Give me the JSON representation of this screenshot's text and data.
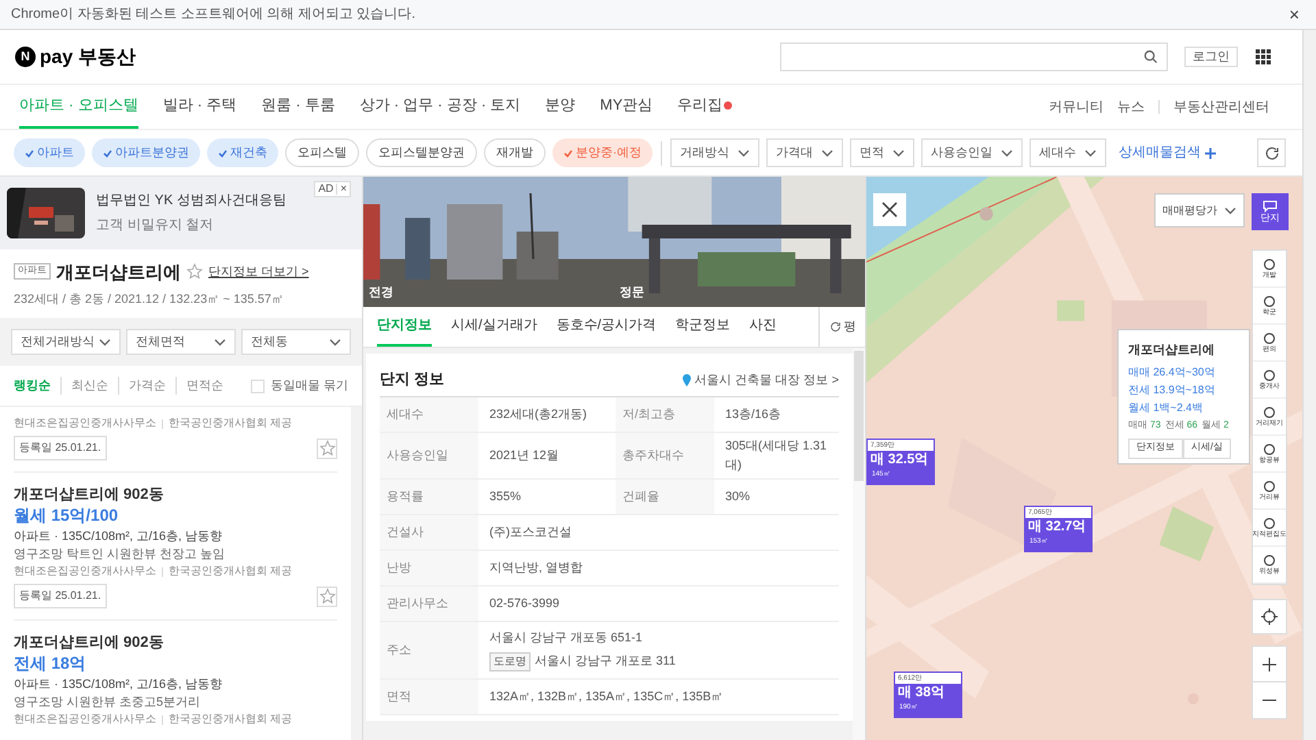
{
  "automation_bar": {
    "text": "Chrome이 자동화된 테스트 소프트웨어에 의해 제어되고 있습니다.",
    "close": "×"
  },
  "header": {
    "logo_mark": "N",
    "logo_text": "pay 부동산",
    "login": "로그인"
  },
  "nav": {
    "tabs": [
      {
        "label": "아파트 · 오피스텔",
        "selected": true,
        "badge": false
      },
      {
        "label": "빌라 · 주택",
        "selected": false,
        "badge": false
      },
      {
        "label": "원룸 · 투룸",
        "selected": false,
        "badge": false
      },
      {
        "label": "상가 · 업무 · 공장 · 토지",
        "selected": false,
        "badge": false
      },
      {
        "label": "분양",
        "selected": false,
        "badge": false
      },
      {
        "label": "MY관심",
        "selected": false,
        "badge": false
      },
      {
        "label": "우리집",
        "selected": false,
        "badge": true
      }
    ],
    "links": [
      "커뮤니티",
      "뉴스",
      "부동산관리센터"
    ]
  },
  "filters": {
    "chips": [
      {
        "label": "아파트",
        "selected": true,
        "kind": "type"
      },
      {
        "label": "아파트분양권",
        "selected": true,
        "kind": "type"
      },
      {
        "label": "재건축",
        "selected": true,
        "kind": "type"
      },
      {
        "label": "오피스텔",
        "selected": false,
        "kind": "type"
      },
      {
        "label": "오피스텔분양권",
        "selected": false,
        "kind": "type"
      },
      {
        "label": "재개발",
        "selected": false,
        "kind": "type"
      },
      {
        "label": "분양중·예정",
        "selected": true,
        "kind": "presale"
      }
    ],
    "dropdowns": [
      "거래방식",
      "가격대",
      "면적",
      "사용승인일",
      "세대수"
    ],
    "detail_search": "상세매물검색"
  },
  "ad": {
    "badge": "AD",
    "close": "×",
    "title": "법무법인 YK 성범죄사건대응팀",
    "subtitle": "고객 비밀유지 철저"
  },
  "complex": {
    "type_badge": "아파트",
    "name": "개포더샵트리에",
    "starred": false,
    "more": "단지정보 더보기 >",
    "summary": "232세대 / 총 2동 / 2021.12 / 132.23㎡ ~ 135.57㎡"
  },
  "list_filters": [
    "전체거래방식",
    "전체면적",
    "전체동"
  ],
  "sort": [
    {
      "label": "랭킹순",
      "selected": true
    },
    {
      "label": "최신순",
      "selected": false
    },
    {
      "label": "가격순",
      "selected": false
    },
    {
      "label": "면적순",
      "selected": false
    }
  ],
  "same_listing": {
    "label": "동일매물 묶기",
    "checked": false
  },
  "listings": [
    {
      "agency": "현대조은집공인중개사사무소",
      "provider": "한국공인중개사협회 제공",
      "date": "등록일 25.01.21.",
      "starred": false
    },
    {
      "title": "개포더샵트리에 902동",
      "price": "월세 15억/100",
      "details": "아파트 · 135C/108m², 고/16층, 남동향",
      "note": "영구조망 탁트인 시원한뷰 천장고 높임",
      "agency": "현대조은집공인중개사사무소",
      "provider": "한국공인중개사협회 제공",
      "date": "등록일 25.01.21.",
      "starred": false
    },
    {
      "title": "개포더샵트리에 902동",
      "price": "전세 18억",
      "details": "아파트 · 135C/108m², 고/16층, 남동향",
      "note": "영구조망 시원한뷰 초중고5분거리",
      "agency": "현대조은집공인중개사사무소",
      "provider": "한국공인중개사협회 제공"
    }
  ],
  "photos": [
    {
      "caption": "전경"
    },
    {
      "caption": "정문"
    }
  ],
  "detail_tabs": [
    {
      "label": "단지정보",
      "selected": true
    },
    {
      "label": "시세/실거래가",
      "selected": false
    },
    {
      "label": "동호수/공시가격",
      "selected": false
    },
    {
      "label": "학군정보",
      "selected": false
    },
    {
      "label": "사진",
      "selected": false
    }
  ],
  "unit_toggle": "평",
  "info": {
    "title": "단지 정보",
    "link": "서울시 건축물 대장 정보 >",
    "rows": [
      {
        "kind": "pair",
        "cells": [
          {
            "label": "세대수",
            "value": "232세대(총2개동)"
          },
          {
            "label": "저/최고층",
            "value": "13층/16층"
          }
        ]
      },
      {
        "kind": "pair",
        "cells": [
          {
            "label": "사용승인일",
            "value": "2021년 12월"
          },
          {
            "label": "총주차대수",
            "value": "305대(세대당 1.31대)"
          }
        ]
      },
      {
        "kind": "pair",
        "cells": [
          {
            "label": "용적률",
            "value": "355%"
          },
          {
            "label": "건폐율",
            "value": "30%"
          }
        ]
      },
      {
        "kind": "single",
        "label": "건설사",
        "value": "(주)포스코건설"
      },
      {
        "kind": "single",
        "label": "난방",
        "value": "지역난방, 열병합"
      },
      {
        "kind": "single",
        "label": "관리사무소",
        "value": "02-576-3999"
      },
      {
        "kind": "address",
        "label": "주소",
        "value": "서울시 강남구 개포동 651-1",
        "road_badge": "도로명",
        "road": "서울시 강남구 개포로 311"
      },
      {
        "kind": "single",
        "label": "면적",
        "value": "132A㎡, 132B㎡, 135A㎡, 135C㎡, 135B㎡"
      }
    ]
  },
  "map": {
    "price_select": "매매평당가",
    "complex_button": "단지",
    "tools": [
      "개발",
      "학군",
      "편의",
      "중개사",
      "거리재기",
      "항공뷰",
      "거리뷰",
      "지적편집도",
      "위성뷰"
    ],
    "popup": {
      "name": "개포더샵트리에",
      "prices": [
        "매매 26.4억~30억",
        "전세 13.9억~18억",
        "월세 1백~2.4백"
      ],
      "counts": [
        {
          "label": "매매",
          "value": "73"
        },
        {
          "label": "전세",
          "value": "66"
        },
        {
          "label": "월세",
          "value": "2"
        }
      ],
      "buttons": [
        "단지정보",
        "시세/실"
      ]
    },
    "markers": [
      {
        "per_pyeong": "7,359만",
        "price": "매 32.5억",
        "area": "145㎡"
      },
      {
        "per_pyeong": "7,065만",
        "price": "매 32.7억",
        "area": "153㎡"
      },
      {
        "per_pyeong": "6,612만",
        "price": "매 38억",
        "area": "190㎡"
      }
    ]
  }
}
